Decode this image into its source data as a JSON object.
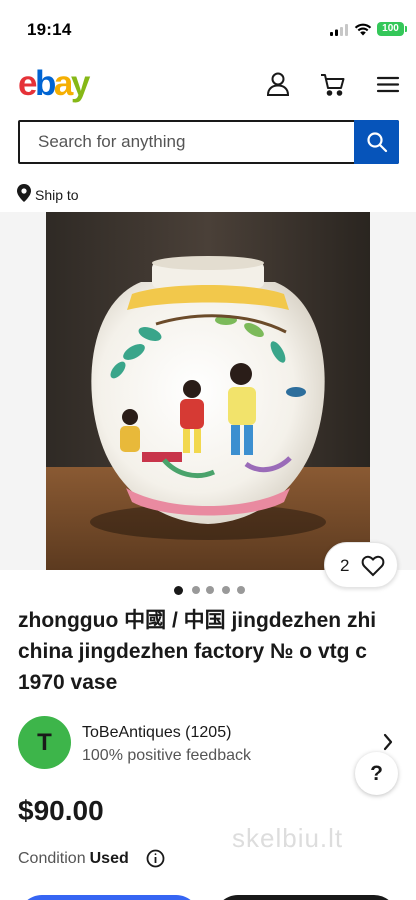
{
  "status_bar": {
    "time": "19:14",
    "battery": "100"
  },
  "header": {
    "logo": [
      "e",
      "b",
      "a",
      "y"
    ]
  },
  "search": {
    "placeholder": "Search for anything"
  },
  "ship_to": {
    "label": "Ship to"
  },
  "listing": {
    "watch_count": "2",
    "image_count": 5,
    "active_image": 1,
    "title": "zhongguo 中國 / 中国 jingdezhen zhi china jingdezhen factory № o vtg c 1970 vase",
    "price": "$90.00",
    "condition_label": "Condition",
    "condition_value": "Used"
  },
  "seller": {
    "initial": "T",
    "name": "ToBeAntiques (1205)",
    "feedback": "100% positive feedback",
    "avatar_color": "#3db54a"
  },
  "help": {
    "label": "?"
  },
  "watermark": {
    "text": "skelbiu.lt"
  },
  "colors": {
    "accent": "#0654ba",
    "primary_button": "#3665f3"
  }
}
